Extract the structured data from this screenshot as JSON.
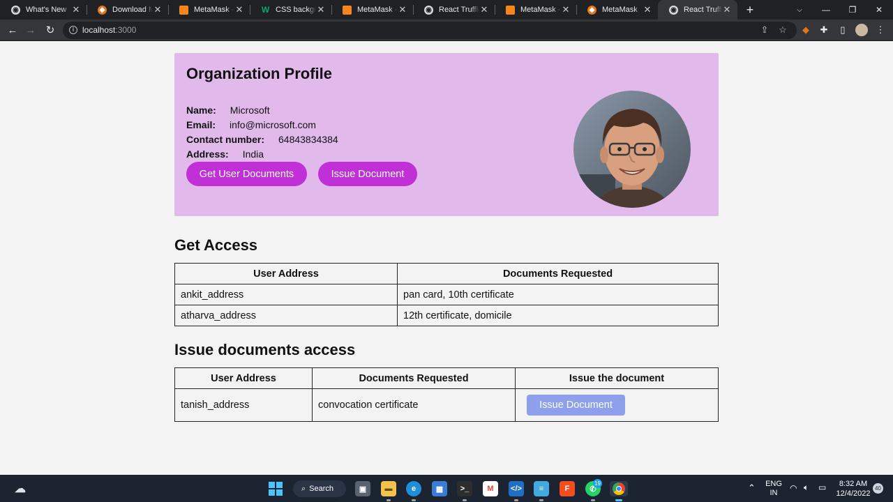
{
  "browser": {
    "tabs": [
      {
        "title": "What's New",
        "icon": "chrome-icon",
        "color": "#dadce0"
      },
      {
        "title": "Download MetaMask",
        "icon": "metamask-fox-icon",
        "color": "#e2761b"
      },
      {
        "title": "MetaMask - Chrome",
        "icon": "metamask-page-icon",
        "color": "#f6851b"
      },
      {
        "title": "CSS background",
        "icon": "w3schools-icon",
        "color": "#04aa6d"
      },
      {
        "title": "MetaMask - Chrome",
        "icon": "metamask-page-icon",
        "color": "#f6851b"
      },
      {
        "title": "React Truffle Box",
        "icon": "react-truffle-icon",
        "color": "#dadce0"
      },
      {
        "title": "MetaMask - Chrome",
        "icon": "metamask-page-icon",
        "color": "#f6851b"
      },
      {
        "title": "MetaMask",
        "icon": "metamask-fox-icon",
        "color": "#e2761b"
      },
      {
        "title": "React Truffle Box",
        "icon": "react-truffle-icon",
        "color": "#dadce0"
      }
    ],
    "url_host": "localhost",
    "url_port": ":3000"
  },
  "profile": {
    "title": "Organization Profile",
    "name_label": "Name:",
    "name_value": "Microsoft",
    "email_label": "Email:",
    "email_value": "info@microsoft.com",
    "contact_label": "Contact number:",
    "contact_value": "64843834384",
    "address_label": "Address:",
    "address_value": "India",
    "get_docs_button": "Get User Documents",
    "issue_doc_button": "Issue Document"
  },
  "get_access": {
    "heading": "Get Access",
    "columns": [
      "User Address",
      "Documents Requested"
    ],
    "rows": [
      [
        "ankit_address",
        "pan card, 10th certificate"
      ],
      [
        "atharva_address",
        "12th certificate, domicile"
      ]
    ]
  },
  "issue_access": {
    "heading": "Issue documents access",
    "columns": [
      "User Address",
      "Documents Requested",
      "Issue the document"
    ],
    "rows": [
      {
        "address": "tanish_address",
        "docs": "convocation certificate",
        "button": "Issue Document"
      }
    ]
  },
  "taskbar": {
    "search_label": "Search",
    "lang_top": "ENG",
    "lang_bottom": "IN",
    "time": "8:32 AM",
    "date": "12/4/2022",
    "whatsapp_badge": "19",
    "notification_count": "40"
  },
  "colors": {
    "profile_bg": "#e1baeb",
    "pill_button": "#c12fd6",
    "issue_button": "#8ea0ec"
  }
}
